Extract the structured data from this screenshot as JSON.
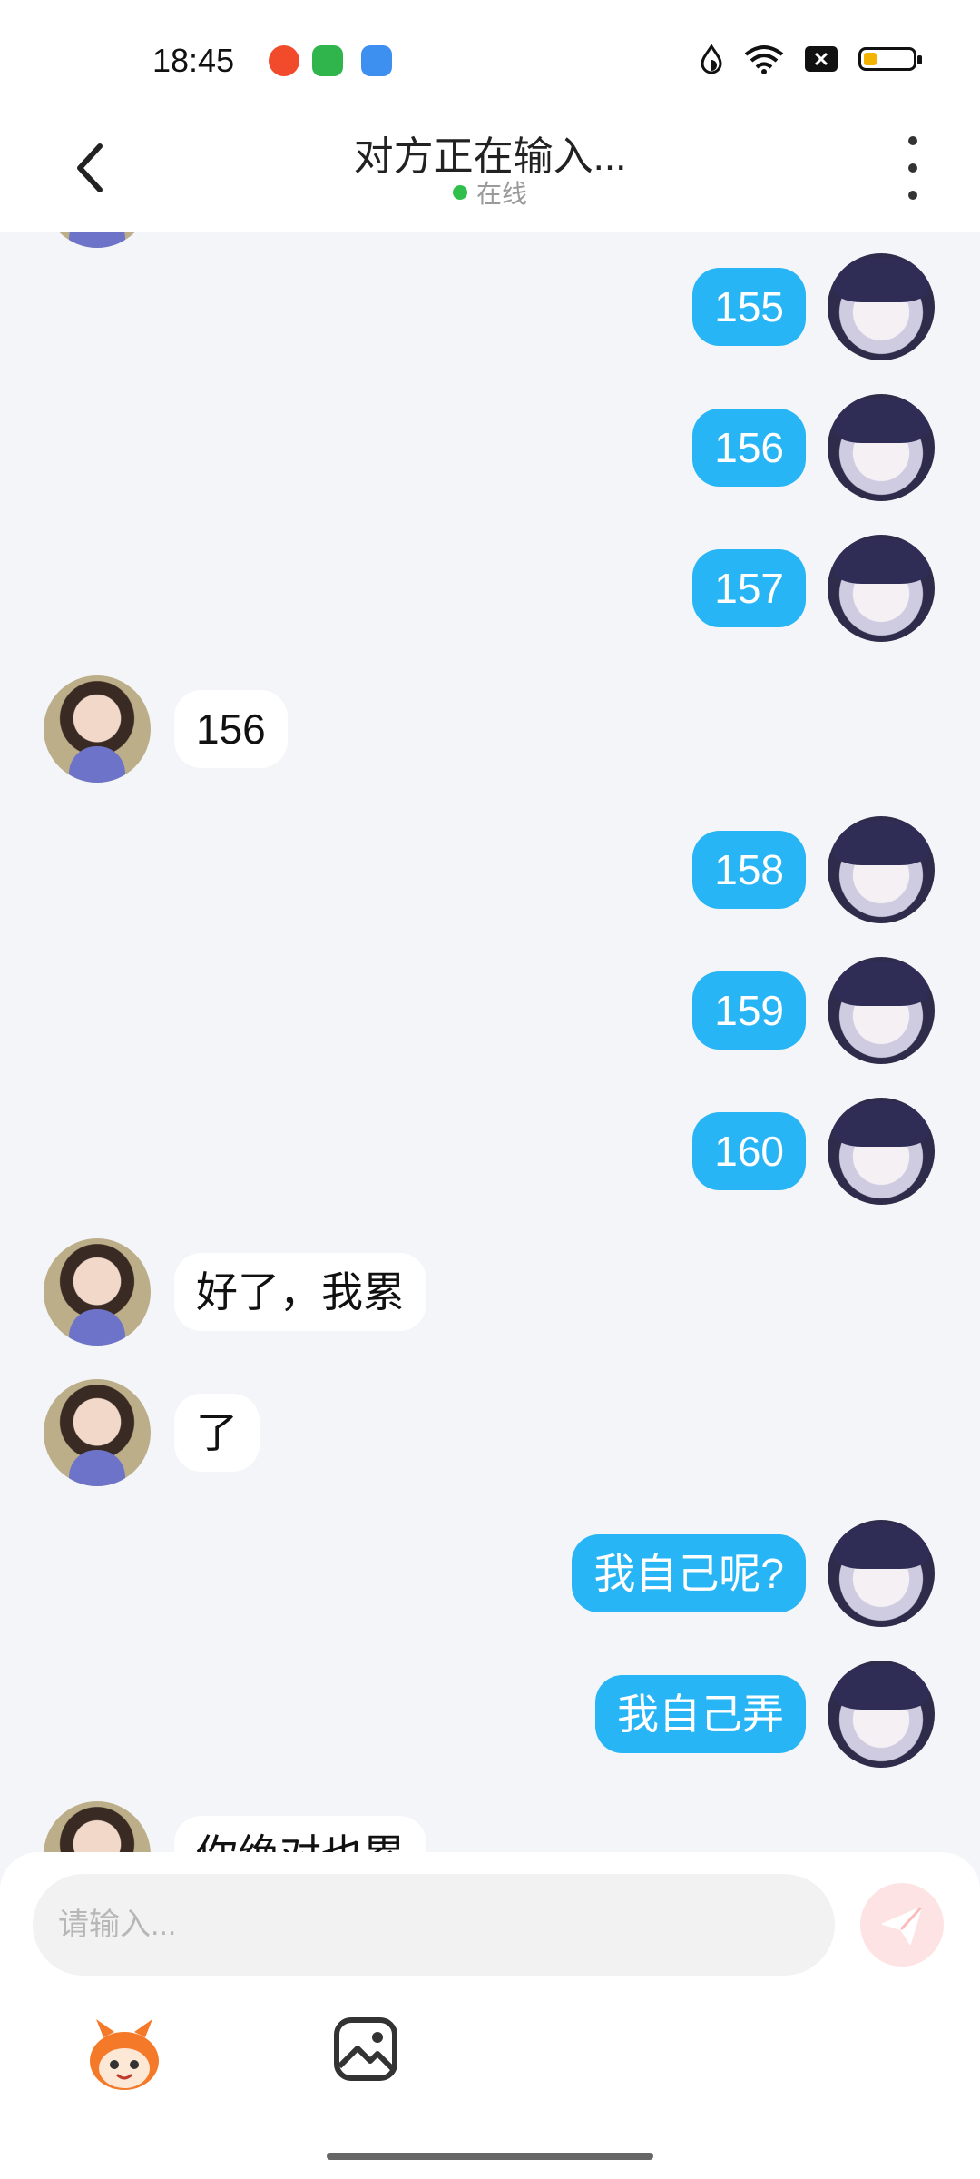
{
  "status_bar": {
    "time": "18:45"
  },
  "header": {
    "title": "对方正在输入...",
    "status": "在线"
  },
  "messages": [
    {
      "from": "me",
      "text": "155"
    },
    {
      "from": "me",
      "text": "156"
    },
    {
      "from": "me",
      "text": "157"
    },
    {
      "from": "other",
      "text": "156"
    },
    {
      "from": "me",
      "text": "158"
    },
    {
      "from": "me",
      "text": "159"
    },
    {
      "from": "me",
      "text": "160"
    },
    {
      "from": "other",
      "text": "好了，我累"
    },
    {
      "from": "other",
      "text": "了"
    },
    {
      "from": "me",
      "text": "我自己呢?"
    },
    {
      "from": "me",
      "text": "我自己弄"
    },
    {
      "from": "other",
      "text": "你绝对也累"
    }
  ],
  "composer": {
    "placeholder": "请输入..."
  },
  "icons": {
    "back": "chevron-left-icon",
    "more": "more-vertical-icon",
    "send": "paper-plane-icon",
    "emoji": "emoji-mascot-icon",
    "image": "image-icon"
  },
  "colors": {
    "bubble_me": "#28b5f6",
    "bubble_other": "#ffffff",
    "online_dot": "#2fbf4a",
    "send_bg": "#fde3e3"
  }
}
